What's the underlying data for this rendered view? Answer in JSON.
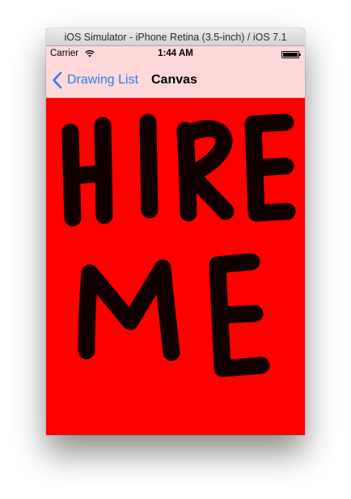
{
  "window": {
    "title": "iOS Simulator - iPhone Retina (3.5-inch) / iOS 7.1"
  },
  "status_bar": {
    "carrier": "Carrier",
    "wifi_icon": "wifi-icon",
    "time": "1:44 AM",
    "battery_icon": "battery-icon"
  },
  "nav_bar": {
    "back_label": "Drawing List",
    "back_icon": "chevron-left-icon",
    "title": "Canvas"
  },
  "canvas": {
    "background_color": "#ff0000",
    "stroke_color": "#000000",
    "drawn_words": [
      "HIRE",
      "ME"
    ]
  },
  "colors": {
    "bar_tint": "#ffd9d9",
    "accent": "#2b7cf5"
  }
}
